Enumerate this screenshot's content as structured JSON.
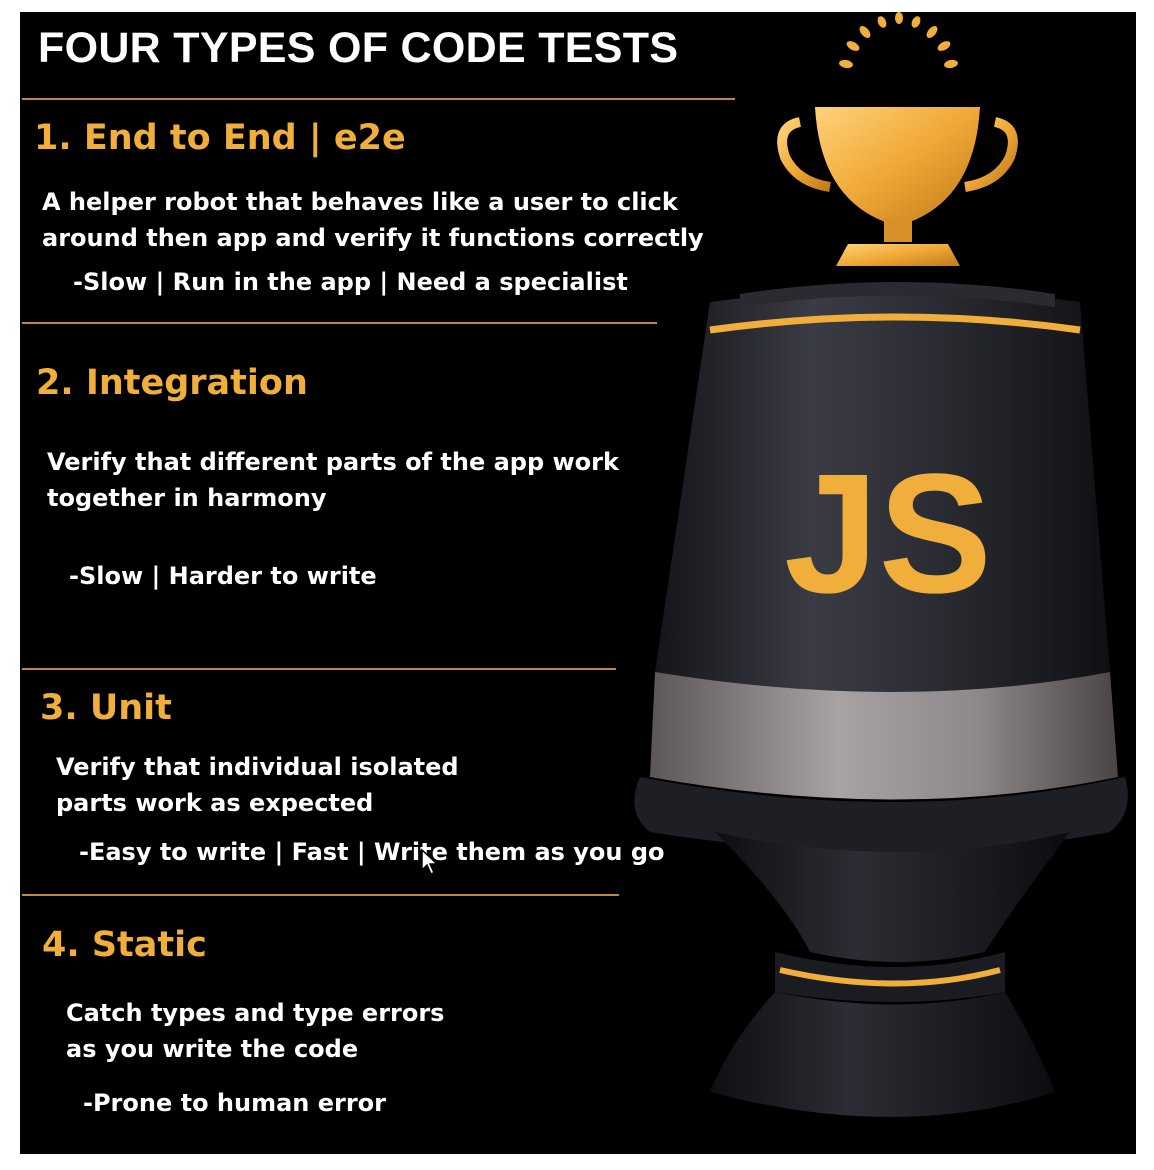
{
  "title": "FOUR TYPES OF CODE TESTS",
  "logo_text": "JS",
  "colors": {
    "accent": "#f0ae3a",
    "background": "#000000",
    "text": "#ffffff",
    "rule": "#c0883a"
  },
  "sections": [
    {
      "heading": "1. End to End | e2e",
      "desc": [
        "A helper robot that behaves like a user to click",
        "around then app and verify it functions correctly"
      ],
      "note": "-Slow | Run in the app | Need a specialist"
    },
    {
      "heading": "2. Integration",
      "desc": [
        "Verify that different parts of the app work",
        "together in harmony"
      ],
      "note": "-Slow | Harder to write"
    },
    {
      "heading": "3. Unit",
      "desc": [
        "Verify that individual isolated",
        "parts work as expected"
      ],
      "note": "-Easy to write | Fast | Write them as you go"
    },
    {
      "heading": "4. Static",
      "desc": [
        "Catch types and type errors",
        "as you write the code"
      ],
      "note": "-Prone to human error"
    }
  ],
  "icons": [
    "trophy-cup-icon",
    "laurel-icon",
    "cursor-icon"
  ]
}
